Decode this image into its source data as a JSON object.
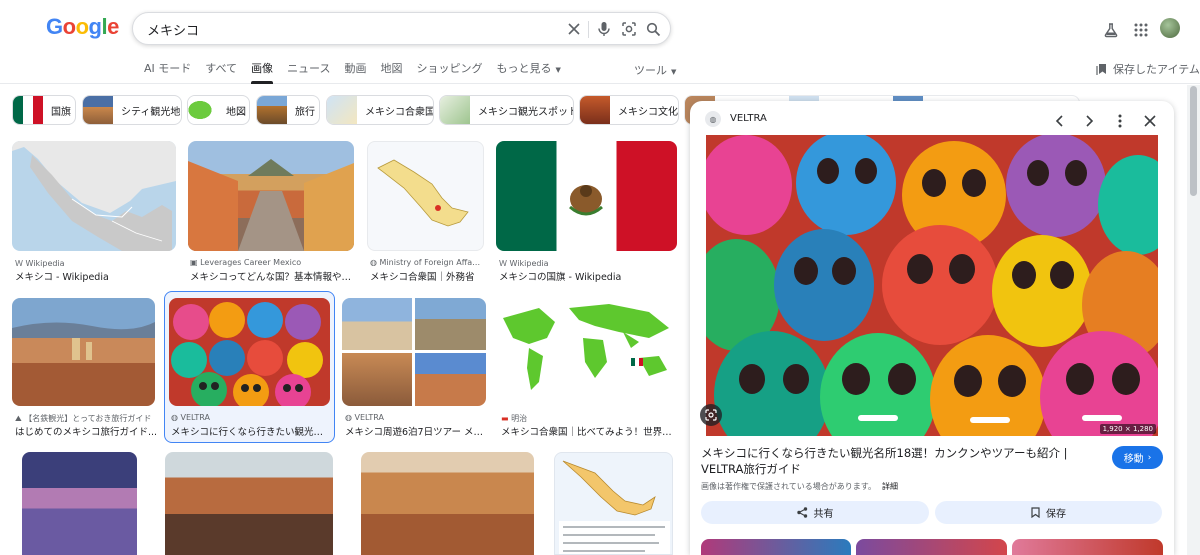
{
  "logo": {
    "letters": [
      "G",
      "o",
      "o",
      "g",
      "l",
      "e"
    ],
    "colors": [
      "#4285F4",
      "#EA4335",
      "#FBBC05",
      "#4285F4",
      "#34A853",
      "#EA4335"
    ]
  },
  "search": {
    "query": "メキシコ",
    "placeholder": ""
  },
  "tabs": [
    {
      "label": "AI モード"
    },
    {
      "label": "すべて"
    },
    {
      "label": "画像",
      "active": true
    },
    {
      "label": "ニュース"
    },
    {
      "label": "動画"
    },
    {
      "label": "地図"
    },
    {
      "label": "ショッピング"
    },
    {
      "label": "もっと見る"
    }
  ],
  "tools_label": "ツール",
  "saved_label": "保存したアイテム",
  "chips": [
    {
      "label": "国旗"
    },
    {
      "label": "シティ観光地"
    },
    {
      "label": "地図"
    },
    {
      "label": "旅行"
    },
    {
      "label": "メキシコ合衆国"
    },
    {
      "label": "メキシコ観光スポット"
    },
    {
      "label": "メキシコ文化"
    }
  ],
  "results": [
    {
      "source": "Wikipedia",
      "title": "メキシコ - Wikipedia"
    },
    {
      "source": "Leverages Career Mexico",
      "title": "メキシコってどんな国？基本情報や国..."
    },
    {
      "source": "Ministry of Foreign Affairs ...",
      "title": "メキシコ合衆国｜外務省"
    },
    {
      "source": "Wikipedia",
      "title": "メキシコの国旗 - Wikipedia"
    },
    {
      "source": "【名鉄観光】とっておき旅行ガイド",
      "title": "はじめてのメキシコ旅行ガイド..."
    },
    {
      "source": "VELTRA",
      "title": "メキシコに行くなら行きたい観光名..."
    },
    {
      "source": "VELTRA",
      "title": "メキシコ周遊6泊7日ツアー メキ..."
    },
    {
      "source": "明治",
      "title": "メキシコ合衆国｜比べてみよう！世界の..."
    }
  ],
  "panel": {
    "source": "VELTRA",
    "title": "メキシコに行くなら行きたい観光名所18選！カンクンやツアーも紹介 | VELTRA旅行ガイド",
    "visit_label": "移動",
    "copyright": "画像は著作権で保護されている場合があります。",
    "details_label": "詳細",
    "share_label": "共有",
    "save_label": "保存",
    "dimensions": "1,920 × 1,280"
  },
  "colors": {
    "accent": "#1a73e8",
    "selected_border": "#4285f4"
  }
}
